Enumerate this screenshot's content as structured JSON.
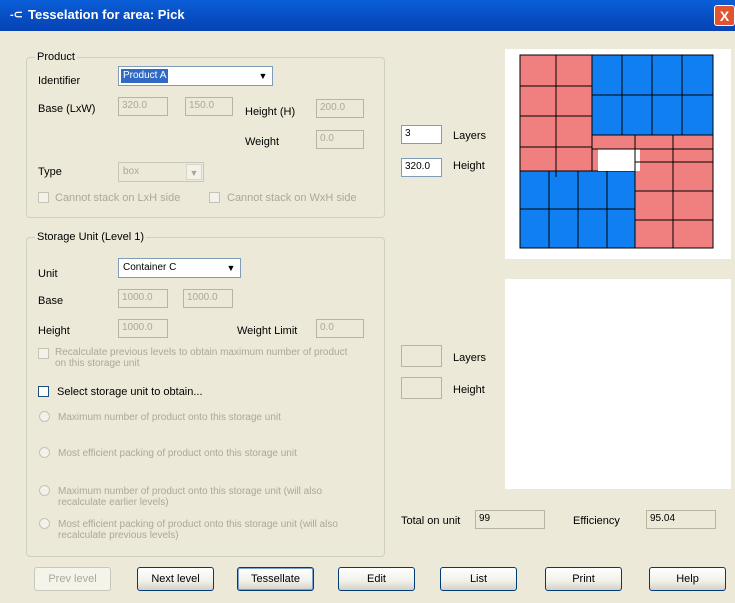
{
  "window": {
    "title": "Tesselation for area: Pick",
    "close_glyph": "X"
  },
  "product": {
    "legend": "Product",
    "identifier_label": "Identifier",
    "identifier_value": "Product A",
    "base_label": "Base (LxW)",
    "base_l": "320.0",
    "base_w": "150.0",
    "height_label": "Height (H)",
    "height_value": "200.0",
    "weight_label": "Weight",
    "weight_value": "0.0",
    "type_label": "Type",
    "type_value": "box",
    "no_stack_lxh": "Cannot stack on LxH side",
    "no_stack_wxh": "Cannot stack on WxH side"
  },
  "storage": {
    "legend": "Storage Unit (Level 1)",
    "unit_label": "Unit",
    "unit_value": "Container C",
    "base_label": "Base",
    "base_l": "1000.0",
    "base_w": "1000.0",
    "height_label": "Height",
    "height_value": "1000.0",
    "weight_limit_label": "Weight Limit",
    "weight_limit_value": "0.0",
    "recalc_label": "Recalculate previous levels to obtain maximum number of product on this storage unit",
    "select_label": "Select storage unit to obtain...",
    "options": [
      "Maximum number of product onto this storage unit",
      "Most efficient packing of product onto this storage unit",
      "Maximum number of product onto this storage unit (will also recalculate earlier levels)",
      "Most efficient packing of product onto this storage unit (will also recalculate previous levels)"
    ]
  },
  "results": {
    "layers_value": "3",
    "layers_label": "Layers",
    "height_value": "320.0",
    "height_label": "Height",
    "layers2_value": "",
    "layers2_label": "Layers",
    "height2_value": "",
    "height2_label": "Height",
    "total_label": "Total on unit",
    "total_value": "99",
    "efficiency_label": "Efficiency",
    "efficiency_value": "95.04"
  },
  "buttons": {
    "prev": "Prev level",
    "next": "Next level",
    "tessellate": "Tessellate",
    "edit": "Edit",
    "list": "List",
    "print": "Print",
    "help": "Help"
  },
  "colors": {
    "pink": "#f08080",
    "blue": "#0f7ff2",
    "titlebar": "#0a5fd8"
  }
}
